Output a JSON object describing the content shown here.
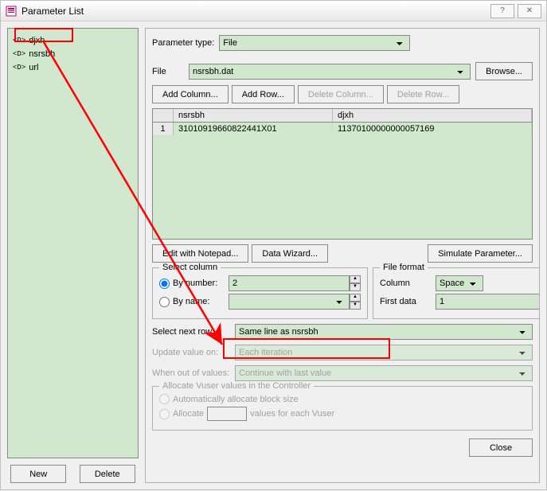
{
  "window": {
    "title": "Parameter List"
  },
  "tree": {
    "items": [
      {
        "label": "djxh",
        "selected": false
      },
      {
        "label": "nsrsbh",
        "selected": false
      },
      {
        "label": "url",
        "selected": false
      }
    ]
  },
  "left_buttons": {
    "new": "New",
    "delete": "Delete"
  },
  "param_type": {
    "label": "Parameter type:",
    "value": "File"
  },
  "file_section": {
    "label": "File",
    "value": "nsrsbh.dat",
    "browse": "Browse...",
    "add_column": "Add Column...",
    "add_row": "Add Row...",
    "delete_column": "Delete Column...",
    "delete_row": "Delete Row..."
  },
  "grid": {
    "headers": [
      "",
      "nsrsbh",
      "djxh"
    ],
    "rows": [
      {
        "num": "1",
        "nsrsbh": "31010919660822441X01",
        "djxh": "11370100000000057169"
      }
    ]
  },
  "mid_buttons": {
    "notepad": "Edit with Notepad...",
    "wizard": "Data Wizard...",
    "simulate": "Simulate Parameter..."
  },
  "select_column": {
    "legend": "Select column",
    "by_number_label": "By number:",
    "by_number_value": "2",
    "by_name_label": "By name:",
    "by_name_value": ""
  },
  "file_format": {
    "legend": "File format",
    "column_label": "Column",
    "column_value": "Space",
    "first_data_label": "First data",
    "first_data_value": "1"
  },
  "select_next_row": {
    "label": "Select next row:",
    "value": "Same line as nsrsbh"
  },
  "update_value": {
    "label": "Update value on:",
    "value": "Each iteration"
  },
  "out_of_values": {
    "label": "When out of values:",
    "value": "Continue with last value"
  },
  "allocate": {
    "legend": "Allocate Vuser values in the Controller",
    "auto": "Automatically allocate block size",
    "alloc_prefix": "Allocate",
    "alloc_suffix": "values for each Vuser"
  },
  "close": "Close",
  "icons": {
    "tag": "<D>"
  }
}
